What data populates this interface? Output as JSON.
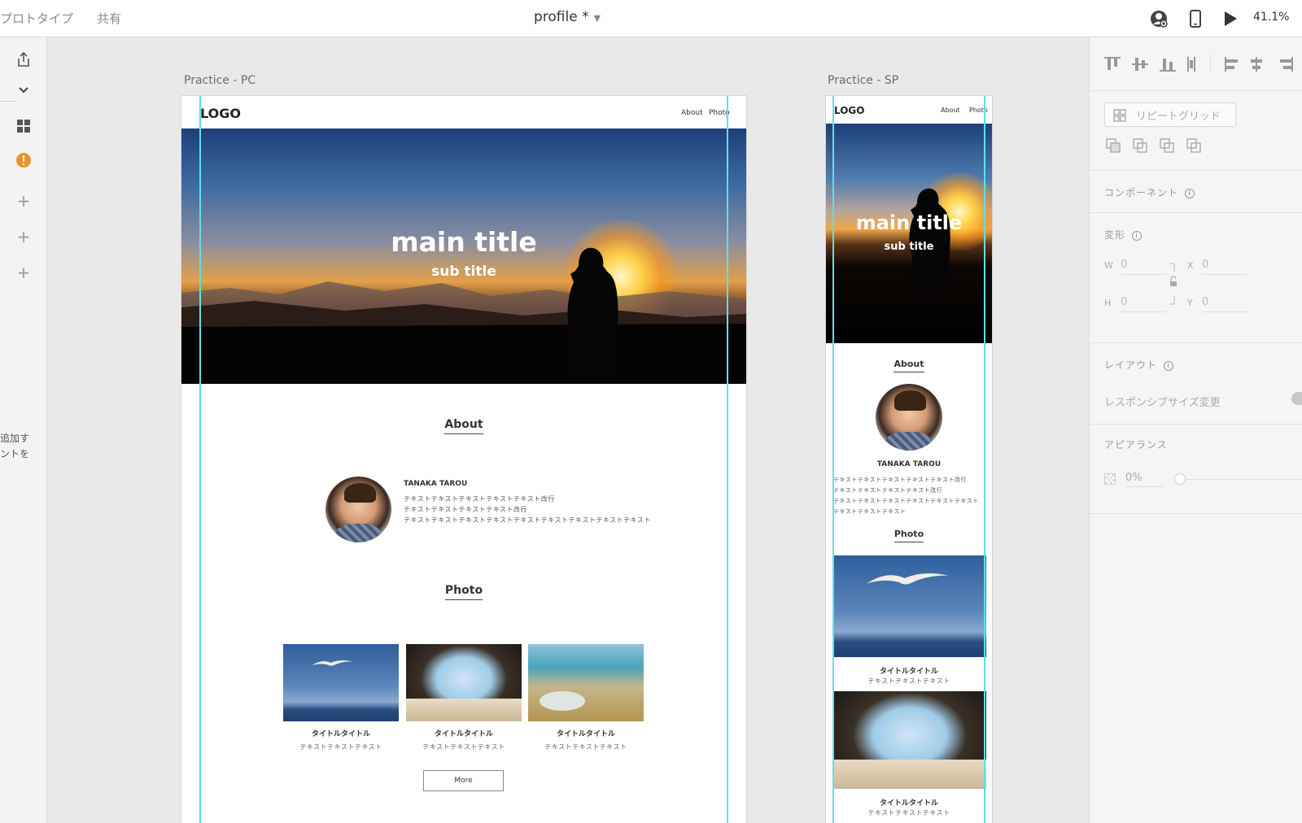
{
  "topbar": {
    "mode_prototype": "プロトタイプ",
    "mode_share": "共有",
    "doc_title": "profile *",
    "zoom": "41.1%"
  },
  "left_hint": {
    "line1": "追加す",
    "line2": "ントを"
  },
  "right_panel": {
    "repeat_grid": "リピートグリッド",
    "component": "コンポーネント",
    "transform": "変形",
    "w_label": "W",
    "w_value": "0",
    "h_label": "H",
    "h_value": "0",
    "x_label": "X",
    "x_value": "0",
    "y_label": "Y",
    "y_value": "0",
    "layout": "レイアウト",
    "responsive": "レスポンシブサイズ変更",
    "appearance": "アピアランス",
    "opacity": "0%"
  },
  "pc": {
    "label": "Practice - PC",
    "logo": "LOGO",
    "nav_about": "About",
    "nav_photo": "Photo",
    "main_title": "main title",
    "sub_title": "sub title",
    "about_heading": "About",
    "name": "TANAKA TAROU",
    "about_lines": [
      "テキストテキストテキストテキストテキスト改行",
      "テキストテキストテキストテキスト改行",
      "テキストテキストテキストテキストテキストテキストテキストテキストテキスト"
    ],
    "photo_heading": "Photo",
    "cards": [
      {
        "title": "タイトルタイトル",
        "sub": "テキストテキストテキスト"
      },
      {
        "title": "タイトルタイトル",
        "sub": "テキストテキストテキスト"
      },
      {
        "title": "タイトルタイトル",
        "sub": "テキストテキストテキスト"
      }
    ],
    "more": "More"
  },
  "sp": {
    "label": "Practice - SP",
    "logo": "LOGO",
    "nav_about": "About",
    "nav_photo": "Photo",
    "main_title": "main title",
    "sub_title": "sub title",
    "about_heading": "About",
    "name": "TANAKA TAROU",
    "about_lines": [
      "テキストテキストテキストテキストテキスト改行",
      "テキストテキストテキストテキスト改行",
      "テキストテキストテキストテキストテキストテキスト",
      "テキストテキストテキスト"
    ],
    "photo_heading": "Photo",
    "cards": [
      {
        "title": "タイトルタイトル",
        "sub": "テキストテキストテキスト"
      },
      {
        "title": "タイトルタイトル",
        "sub": "テキストテキストテキスト"
      }
    ]
  },
  "colors": {
    "guide": "#5fe0e6",
    "warning": "#e8912d"
  }
}
